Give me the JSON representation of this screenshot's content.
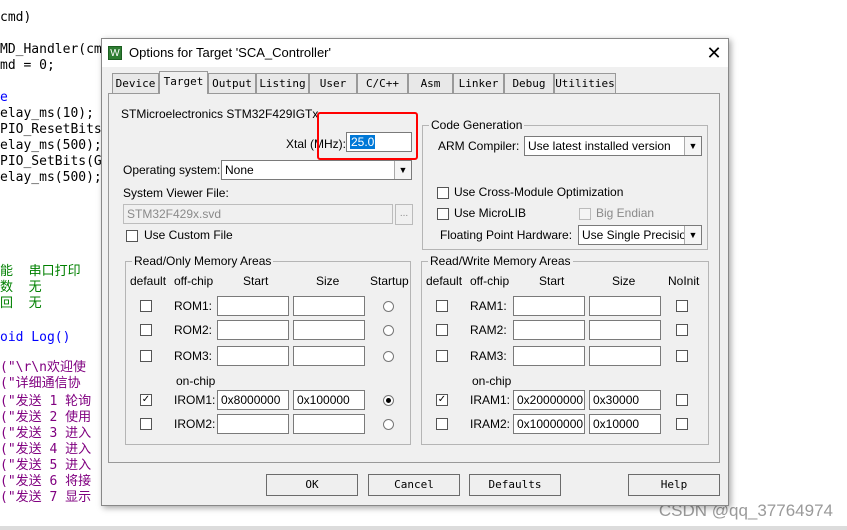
{
  "editor": {
    "lines": [
      {
        "text": "cmd)",
        "color": "black"
      },
      {
        "text": "MD_Handler(cmd",
        "color": "black"
      },
      {
        "text": "md = 0;",
        "color": "black"
      },
      {
        "text": "e",
        "color": "blue"
      },
      {
        "text": "elay_ms(10);",
        "color": "black"
      },
      {
        "text": "PIO_ResetBits",
        "color": "black"
      },
      {
        "text": "elay_ms(500);",
        "color": "black"
      },
      {
        "text": "PIO_SetBits(G",
        "color": "black"
      },
      {
        "text": "elay_ms(500);",
        "color": "black"
      },
      {
        "text": "能  串口打印",
        "color": "green"
      },
      {
        "text": "数  无",
        "color": "green"
      },
      {
        "text": "回  无",
        "color": "green"
      },
      {
        "text": "oid Log()",
        "color": "blue"
      },
      {
        "text": "(\"\\r\\n欢迎使",
        "color": "purple"
      },
      {
        "text": "(\"详细通信协",
        "color": "purple"
      },
      {
        "text": "(\"发送 1 轮询",
        "color": "purple"
      },
      {
        "text": "(\"发送 2 使用",
        "color": "purple"
      },
      {
        "text": "(\"发送 3 进入",
        "color": "purple"
      },
      {
        "text": "(\"发送 4 进入",
        "color": "purple"
      },
      {
        "text": "(\"发送 5 进入",
        "color": "purple"
      },
      {
        "text": "(\"发送 6 将接",
        "color": "purple"
      },
      {
        "text": "(\"发送 7 显示",
        "color": "purple"
      }
    ],
    "watermark": "CSDN @qq_37764974"
  },
  "dialog": {
    "title": "Options for Target 'SCA_Controller'",
    "close_glyph": "✕",
    "app_icon_glyph": "W",
    "tabs": [
      {
        "label": "Device",
        "active": false
      },
      {
        "label": "Target",
        "active": true
      },
      {
        "label": "Output",
        "active": false
      },
      {
        "label": "Listing",
        "active": false
      },
      {
        "label": "User",
        "active": false
      },
      {
        "label": "C/C++",
        "active": false
      },
      {
        "label": "Asm",
        "active": false
      },
      {
        "label": "Linker",
        "active": false
      },
      {
        "label": "Debug",
        "active": false
      },
      {
        "label": "Utilities",
        "active": false
      }
    ],
    "device_name": "STMicroelectronics STM32F429IGTx",
    "xtal_label": "Xtal (MHz):",
    "xtal_value": "25.0",
    "os_label": "Operating system:",
    "os_value": "None",
    "svf_label": "System Viewer File:",
    "svf_value": "STM32F429x.svd",
    "svf_browse": "...",
    "custom_file_label": "Use Custom File",
    "custom_file_checked": false,
    "code_gen": {
      "title": "Code Generation",
      "arm_compiler_label": "ARM Compiler:",
      "arm_compiler_value": "Use latest installed version",
      "cross_module_label": "Use Cross-Module Optimization",
      "cross_module_checked": false,
      "microlib_label": "Use MicroLIB",
      "microlib_checked": false,
      "big_endian_label": "Big Endian",
      "big_endian_checked": false,
      "fph_label": "Floating Point Hardware:",
      "fph_value": "Use Single Precision"
    },
    "rom": {
      "title": "Read/Only Memory Areas",
      "headers": {
        "default": "default",
        "offchip": "off-chip",
        "start": "Start",
        "size": "Size",
        "last": "Startup"
      },
      "onchip_label": "on-chip",
      "rows": [
        {
          "name": "ROM1:",
          "default": false,
          "start": "",
          "size": "",
          "last": false
        },
        {
          "name": "ROM2:",
          "default": false,
          "start": "",
          "size": "",
          "last": false
        },
        {
          "name": "ROM3:",
          "default": false,
          "start": "",
          "size": "",
          "last": false
        },
        {
          "name": "IROM1:",
          "default": true,
          "start": "0x8000000",
          "size": "0x100000",
          "last": true
        },
        {
          "name": "IROM2:",
          "default": false,
          "start": "",
          "size": "",
          "last": false
        }
      ]
    },
    "ram": {
      "title": "Read/Write Memory Areas",
      "headers": {
        "default": "default",
        "offchip": "off-chip",
        "start": "Start",
        "size": "Size",
        "last": "NoInit"
      },
      "onchip_label": "on-chip",
      "rows": [
        {
          "name": "RAM1:",
          "default": false,
          "start": "",
          "size": "",
          "last": false
        },
        {
          "name": "RAM2:",
          "default": false,
          "start": "",
          "size": "",
          "last": false
        },
        {
          "name": "RAM3:",
          "default": false,
          "start": "",
          "size": "",
          "last": false
        },
        {
          "name": "IRAM1:",
          "default": true,
          "start": "0x20000000",
          "size": "0x30000",
          "last": false
        },
        {
          "name": "IRAM2:",
          "default": false,
          "start": "0x10000000",
          "size": "0x10000",
          "last": false
        }
      ]
    },
    "buttons": {
      "ok": "OK",
      "cancel": "Cancel",
      "defaults": "Defaults",
      "help": "Help"
    },
    "annotation_color": "#ff0000",
    "check_glyph": "✓"
  }
}
